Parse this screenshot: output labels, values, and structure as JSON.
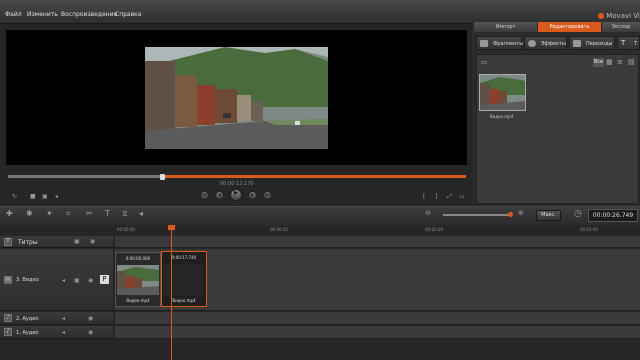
{
  "menu": [
    "Файл",
    "Изменить",
    "Воспроизведение",
    "Справка"
  ],
  "app_brand": "Movavi Vide",
  "mode_tabs": [
    "Импорт",
    "Редактировать",
    "Экспор"
  ],
  "active_mode_tab": "Редактировать",
  "sub_tabs": [
    "Фрагменты",
    "Эффекты",
    "Переходы",
    "Т"
  ],
  "media_filter": "Все",
  "media_items": [
    {
      "label": "Видео.mp4"
    }
  ],
  "player": {
    "timecode": "00:00:12.170"
  },
  "toolbar": {
    "max_label": "Макс.",
    "duration": "00:00:26.749"
  },
  "ruler_ticks": [
    "00:00:00",
    "00:00:10",
    "00:00:20",
    "00:01:00"
  ],
  "tracks": [
    {
      "name": "Титры",
      "type": "text"
    },
    {
      "name": "3. Видео",
      "type": "video"
    },
    {
      "name": "2. Аудио",
      "type": "audio"
    },
    {
      "name": "1. Аудио",
      "type": "audio"
    }
  ],
  "clips": [
    {
      "start": "0:00:00.000",
      "name": "Видео.mp4"
    },
    {
      "start": "0:00:17.740",
      "name": "Видео.mp4"
    }
  ],
  "colors": {
    "accent": "#d95a1c",
    "background": "#262626",
    "panel": "#2b2b2b"
  }
}
